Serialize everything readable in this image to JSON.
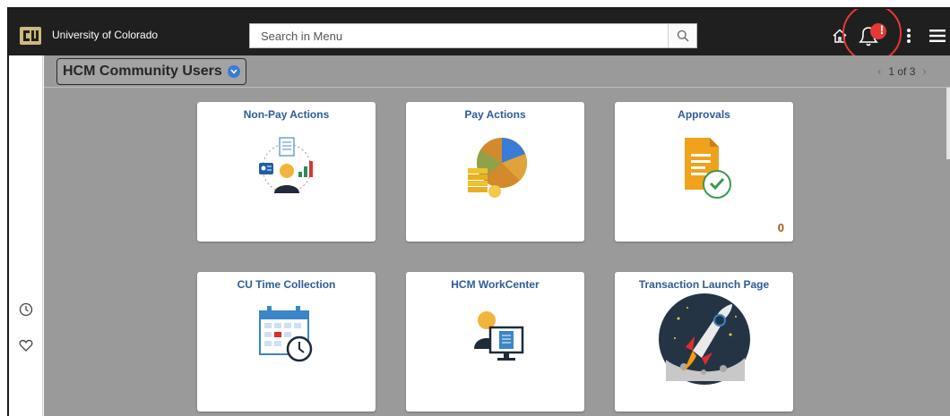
{
  "header": {
    "org_name": "University of Colorado",
    "search_placeholder": "Search in Menu",
    "notification_badge": "!"
  },
  "left_rail": {
    "items": [
      {
        "name": "recent-places",
        "icon": "clock-icon"
      },
      {
        "name": "my-favorites",
        "icon": "heart-icon"
      }
    ]
  },
  "homepage": {
    "selector_label": "HCM Community Users",
    "pager_text": "1 of 3"
  },
  "tiles": [
    {
      "title": "Non-Pay Actions",
      "icon": "person-with-documents-icon"
    },
    {
      "title": "Pay Actions",
      "icon": "pie-chart-coins-icon"
    },
    {
      "title": "Approvals",
      "icon": "approved-document-icon",
      "count": "0"
    },
    {
      "title": "CU Time Collection",
      "icon": "calendar-clock-icon"
    },
    {
      "title": "HCM WorkCenter",
      "icon": "person-computer-icon"
    },
    {
      "title": "Transaction Launch Page",
      "icon": "rocket-icon"
    }
  ],
  "colors": {
    "topbar": "#1f1f1f",
    "content_bg": "#9a9a9a",
    "tile_title": "#2e5b9a",
    "badge": "#e53935",
    "count": "#a05a13"
  }
}
